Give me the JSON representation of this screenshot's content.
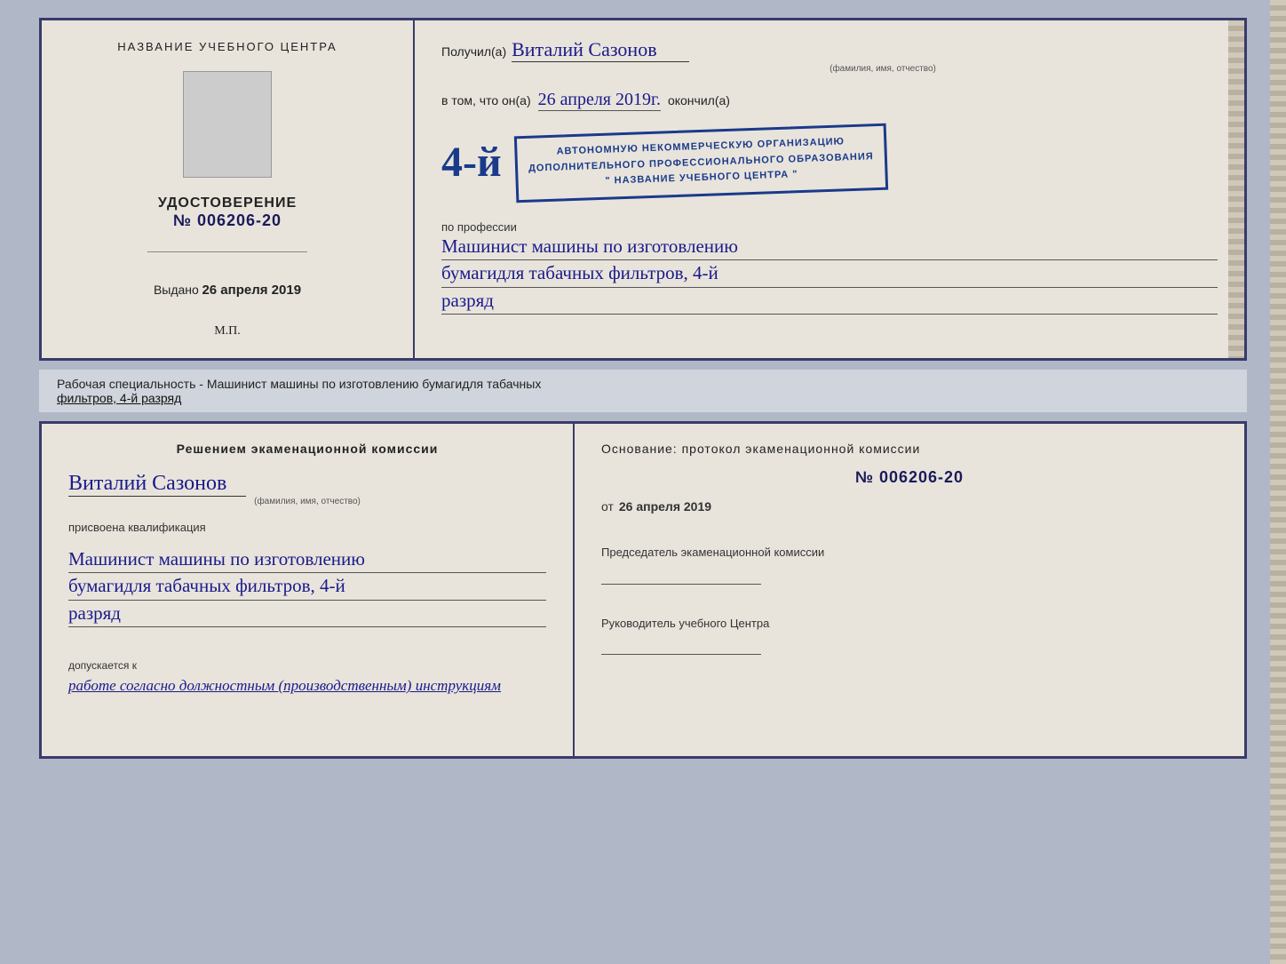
{
  "top_doc": {
    "left": {
      "center_title": "НАЗВАНИЕ УЧЕБНОГО ЦЕНТРА",
      "cert_label": "УДОСТОВЕРЕНИЕ",
      "cert_number": "№ 006206-20",
      "issued_label": "Выдано",
      "issued_date": "26 апреля 2019",
      "mp": "М.П."
    },
    "right": {
      "recipient_prefix": "Получил(а)",
      "recipient_name": "Виталий Сазонов",
      "recipient_sub": "(фамилия, имя, отчество)",
      "intro": "в том, что он(а)",
      "date_handwritten": "26 апреля 2019г.",
      "finished": "окончил(а)",
      "stamp_line1": "АВТОНОМНУЮ НЕКОММЕРЧЕСКУЮ ОРГАНИЗАЦИЮ",
      "stamp_line2": "ДОПОЛНИТЕЛЬНОГО ПРОФЕССИОНАЛЬНОГО ОБРАЗОВАНИЯ",
      "stamp_line3": "\" НАЗВАНИЕ УЧЕБНОГО ЦЕНТРА \"",
      "stamp_number": "4-й",
      "profession_prefix": "по профессии",
      "profession_line1": "Машинист машины по изготовлению",
      "profession_line2": "бумагидля табачных фильтров, 4-й",
      "profession_line3": "разряд"
    }
  },
  "speciality_bar": {
    "text": "Рабочая специальность - Машинист машины по изготовлению бумагидля табачных",
    "underline": "фильтров, 4-й разряд"
  },
  "bottom_doc": {
    "left": {
      "title": "Решением экаменационной комиссии",
      "person_name": "Виталий Сазонов",
      "person_sub": "(фамилия, имя, отчество)",
      "assigned_label": "присвоена квалификация",
      "qual_line1": "Машинист машины по изготовлению",
      "qual_line2": "бумагидля табачных фильтров, 4-й",
      "qual_line3": "разряд",
      "allowed_prefix": "допускается к",
      "allowed_text": "работе согласно должностным (производственным) инструкциям"
    },
    "right": {
      "basis_label": "Основание: протокол экаменационной комиссии",
      "number": "№ 006206-20",
      "date_prefix": "от",
      "date": "26 апреля 2019",
      "chairman_label": "Председатель экаменационной комиссии",
      "director_label": "Руководитель учебного Центра"
    }
  }
}
